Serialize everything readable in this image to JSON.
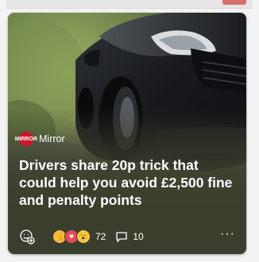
{
  "card": {
    "source": {
      "name": "Mirror",
      "logo_text": "MIRROR",
      "logo_color": "#d0162a"
    },
    "headline": "Drivers share 20p trick that could help you avoid £2,500 fine and penalty points",
    "reactions": {
      "icons": [
        "thumbs-up-icon",
        "heart-icon",
        "surprised-face-icon"
      ],
      "count": "72"
    },
    "comments": {
      "icon": "comment-icon",
      "count": "10"
    },
    "more_label": "···",
    "image_subject": "black car driving on country road",
    "colors": {
      "card_background": "#3a3f2d",
      "text": "#ffffff",
      "logo": "#d0162a"
    }
  }
}
